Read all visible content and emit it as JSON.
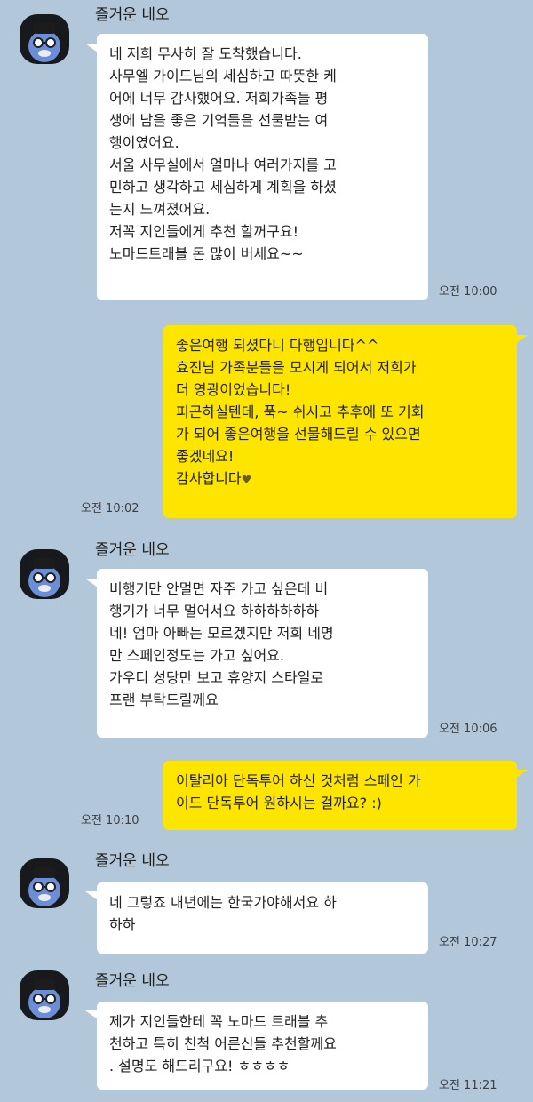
{
  "sender_name": "즐거운 네오",
  "messages": [
    {
      "direction": "in",
      "lines": [
        "네 저희 무사히 잘 도착했습니다.",
        "사무엘 가이드님의 세심하고 따뜻한 케",
        "어에 너무 감사했어요. 저희가족들 평",
        "생에 남을 좋은 기억들을 선물받는 여",
        "행이였어요.",
        "서울 사무실에서 얼마나 여러가지를 고",
        "민하고 생각하고 세심하게 계획을 하셨",
        "는지 느껴졌어요.",
        "저꼭 지인들에게 추천 할꺼구요!",
        "노마드트래블 돈 많이 버세요~~"
      ],
      "time": "오전 10:00"
    },
    {
      "direction": "out",
      "lines": [
        "좋은여행 되셨다니 다행입니다^^",
        "효진님 가족분들을 모시게 되어서 저희가",
        "더 영광이었습니다!",
        "피곤하실텐데, 푹~ 쉬시고 추후에 또 기회",
        "가 되어 좋은여행을 선물해드릴 수 있으면",
        " 좋겠네요!",
        "감사합니다"
      ],
      "time": "오전 10:02"
    },
    {
      "direction": "in",
      "lines": [
        "비행기만 안멀면 자주 가고 싶은데 비",
        "행기가 너무 멀어서요 하하하하하하",
        "네! 엄마 아빠는 모르겠지만 저희 네명",
        "만 스페인정도는 가고 싶어요.",
        "가우디 성당만 보고 휴양지 스타일로",
        "프랜 부탁드릴께요"
      ],
      "time": "오전 10:06"
    },
    {
      "direction": "out",
      "lines": [
        "이탈리아 단독투어 하신 것처럼 스페인 가",
        "이드 단독투어 원하시는 걸까요? :)"
      ],
      "time": "오전 10:10"
    },
    {
      "direction": "in",
      "lines": [
        "네 그렇죠 내년에는 한국가야해서요 하",
        "하하"
      ],
      "time": "오전 10:27"
    },
    {
      "direction": "in",
      "lines": [
        "제가 지인들한테 꼭 노마드 트래블 추",
        "천하고 특히 친척 어른신들 추천할께요",
        ". 설명도 해드리구요! ㅎㅎㅎㅎ"
      ],
      "time": "오전 11:21"
    }
  ]
}
